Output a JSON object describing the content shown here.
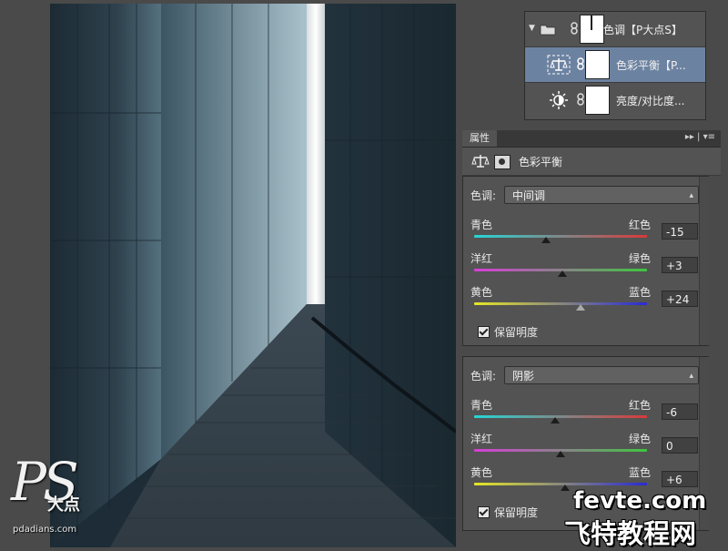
{
  "layers": {
    "group": {
      "name": "色调【P大点S】",
      "icon": "folder-icon",
      "expanded": true
    },
    "items": [
      {
        "name": "色彩平衡【P...",
        "icon": "color-balance-icon",
        "selected": true
      },
      {
        "name": "亮度/对比度...",
        "icon": "brightness-icon",
        "selected": false
      }
    ]
  },
  "properties": {
    "tab_label": "属性",
    "menu_glyph": "▸▸ | ▾≡",
    "adjustment_title": "色彩平衡",
    "panels": [
      {
        "tone_label": "色调:",
        "tone_value": "中间调",
        "sliders": [
          {
            "left": "青色",
            "right": "红色",
            "value": "-15",
            "amount": -15
          },
          {
            "left": "洋红",
            "right": "绿色",
            "value": "+3",
            "amount": 3
          },
          {
            "left": "黄色",
            "right": "蓝色",
            "value": "+24",
            "amount": 24
          }
        ],
        "preserve_label": "保留明度",
        "preserve_checked": true
      },
      {
        "tone_label": "色调:",
        "tone_value": "阴影",
        "sliders": [
          {
            "left": "青色",
            "right": "红色",
            "value": "-6",
            "amount": -6
          },
          {
            "left": "洋红",
            "right": "绿色",
            "value": "0",
            "amount": 0
          },
          {
            "left": "黄色",
            "right": "蓝色",
            "value": "+6",
            "amount": 6
          }
        ],
        "preserve_label": "保留明度",
        "preserve_checked": true
      }
    ]
  },
  "logo": {
    "ps": "PS",
    "cn": "大点",
    "url": "pdadians.com"
  },
  "watermark": {
    "line1": "fevte.com",
    "line2": "飞特教程网"
  },
  "colors": {
    "canvas": "#1b2a34",
    "panel": "#535353",
    "selected_layer": "#6c82a1"
  }
}
